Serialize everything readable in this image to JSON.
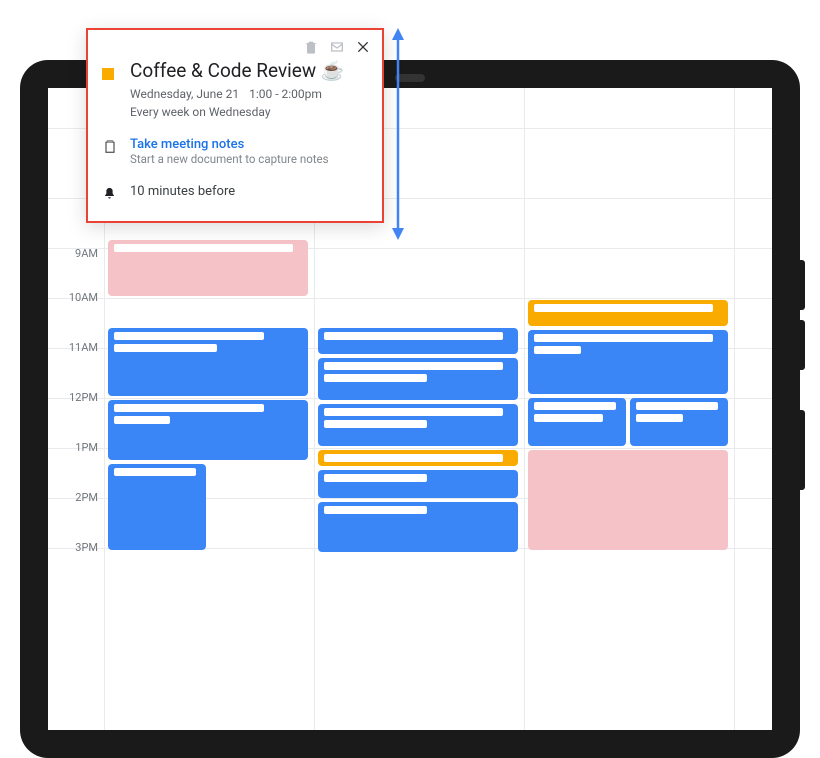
{
  "popup": {
    "title": "Coffee & Code Review ☕",
    "date": "Wednesday, June 21",
    "time": "1:00 - 2:00pm",
    "recurrence": "Every week on Wednesday",
    "notes_link": "Take meeting notes",
    "notes_sub": "Start a new document to capture notes",
    "reminder": "10 minutes before",
    "color": "#f9ab00"
  },
  "time_labels": [
    "9AM",
    "10AM",
    "11AM",
    "12PM",
    "1PM",
    "2PM",
    "3PM"
  ],
  "colors": {
    "blue": "#3b86f7",
    "orange": "#f9ab00",
    "pink": "#f5c2c7",
    "highlight": "#ea4335",
    "arrow": "#4285f4"
  }
}
